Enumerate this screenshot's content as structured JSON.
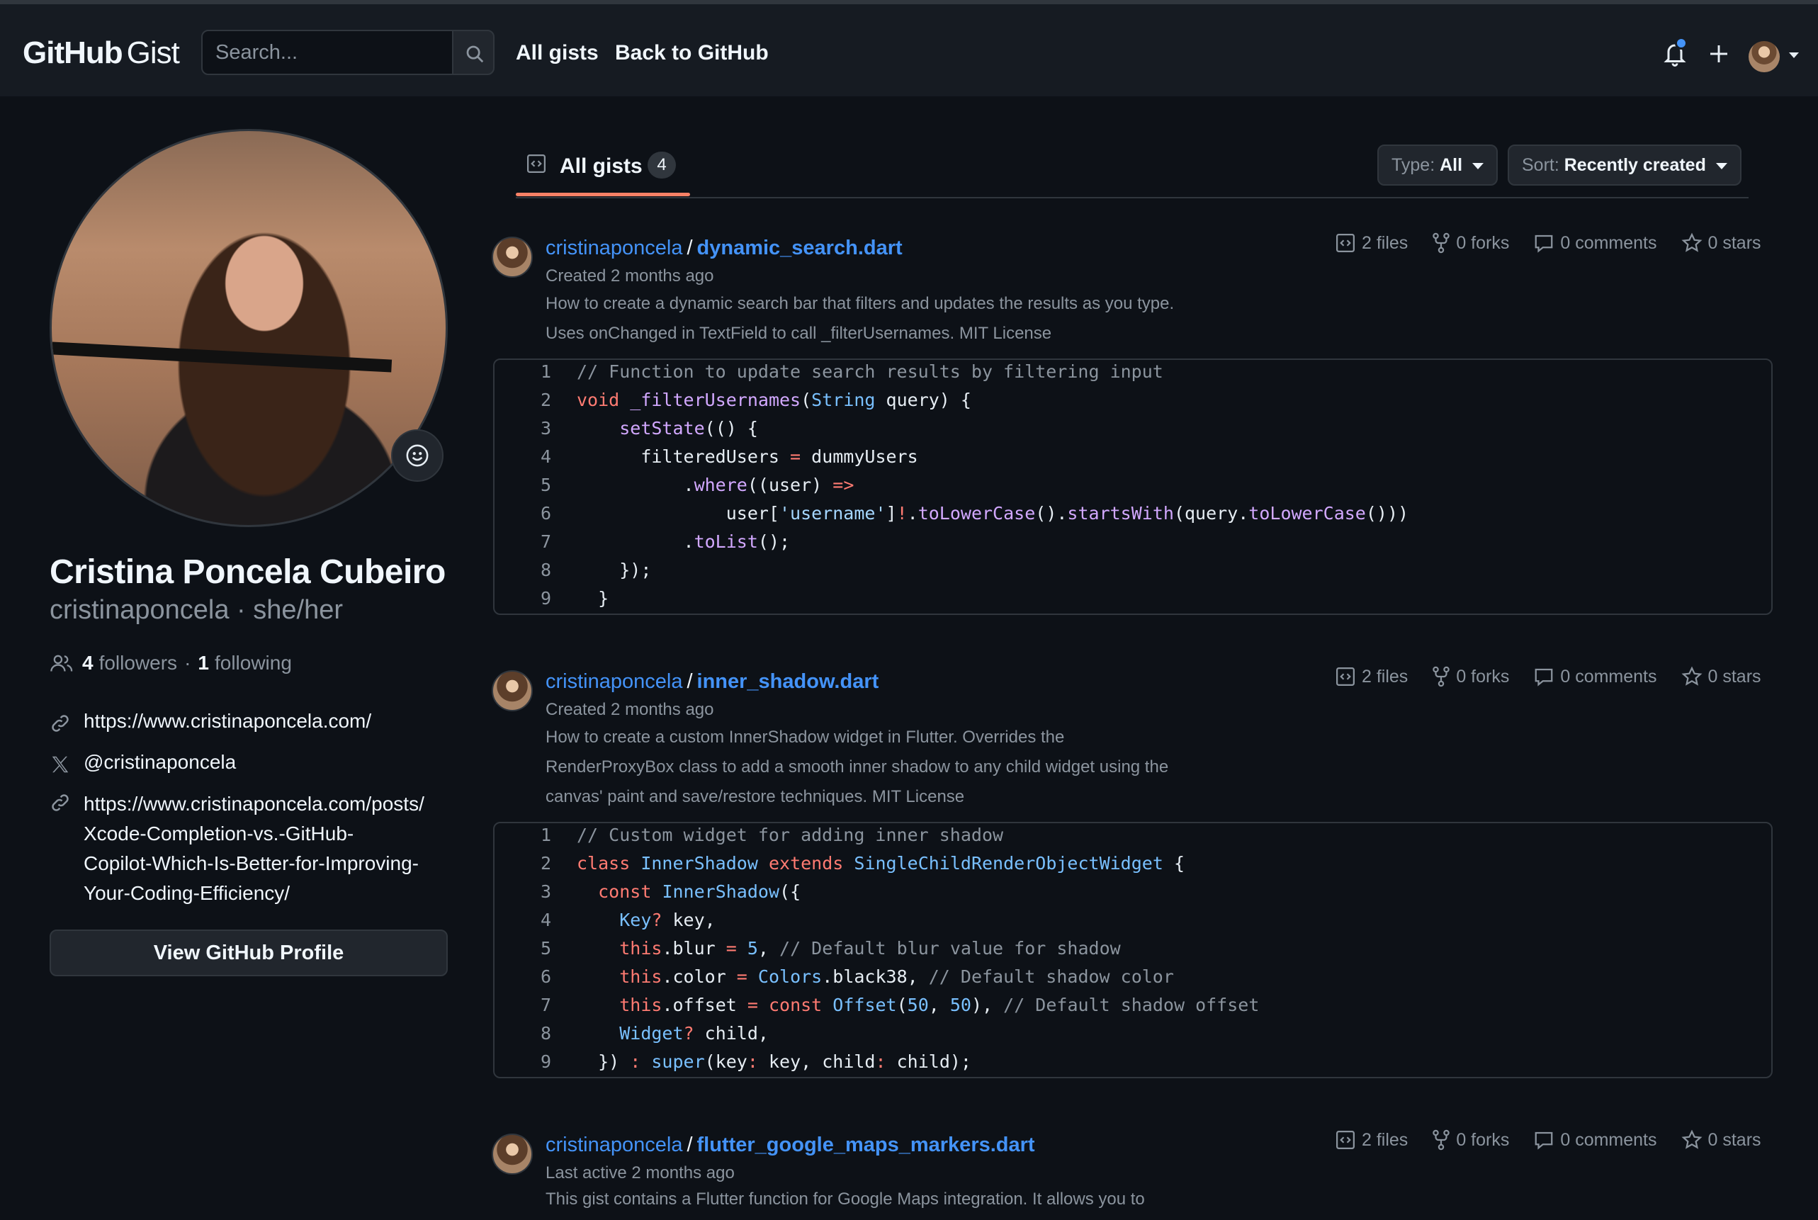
{
  "header": {
    "logo_brand": "GitHub",
    "logo_product": "Gist",
    "search_placeholder": "Search...",
    "nav": [
      "All gists",
      "Back to GitHub"
    ],
    "icons": [
      "bell-icon",
      "plus-icon",
      "avatar",
      "caret-down-icon"
    ],
    "accent": "#4493f8"
  },
  "profile": {
    "full_name": "Cristina Poncela Cubeiro",
    "handle_line": "cristinaponcela · she/her",
    "followers_count": "4",
    "followers_label": "followers",
    "separator": "·",
    "following_count": "1",
    "following_label": "following",
    "website": "https://www.cristinaponcela.com/",
    "twitter": "@cristinaponcela",
    "post_link_lines": [
      "https://www.cristinaponcela.com/posts/",
      "Xcode-Completion-vs.-GitHub-",
      "Copilot-Which-Is-Better-for-Improving-",
      "Your-Coding-Efficiency/"
    ],
    "view_profile_button": "View GitHub Profile"
  },
  "tabs": {
    "all_gists_label": "All gists",
    "all_gists_count": "4",
    "type_filter_label": "Type:",
    "type_filter_value": "All",
    "sort_filter_label": "Sort:",
    "sort_filter_value": "Recently created"
  },
  "gists": [
    {
      "owner": "cristinaponcela",
      "slash": "/",
      "file": "dynamic_search.dart",
      "meta": "Created 2 months ago",
      "desc_lines": [
        "How to create a dynamic search bar that filters and updates the results as you type.",
        "Uses onChanged in TextField to call _filterUsernames. MIT License"
      ],
      "files": "2 files",
      "forks": "0 forks",
      "comments": "0 comments",
      "stars": "0 stars"
    },
    {
      "owner": "cristinaponcela",
      "slash": "/",
      "file": "inner_shadow.dart",
      "meta": "Created 2 months ago",
      "desc_lines": [
        "How to create a custom InnerShadow widget in Flutter. Overrides the",
        "RenderProxyBox class to add a smooth inner shadow to any child widget using the",
        "canvas' paint and save/restore techniques. MIT License"
      ],
      "files": "2 files",
      "forks": "0 forks",
      "comments": "0 comments",
      "stars": "0 stars"
    },
    {
      "owner": "cristinaponcela",
      "slash": "/",
      "file": "flutter_google_maps_markers.dart",
      "meta": "Last active 2 months ago",
      "desc_lines": [
        "This gist contains a Flutter function for Google Maps integration. It allows you to"
      ],
      "files": "2 files",
      "forks": "0 forks",
      "comments": "0 comments",
      "stars": "0 stars"
    }
  ],
  "code1": {
    "line_numbers": [
      "1",
      "2",
      "3",
      "4",
      "5",
      "6",
      "7",
      "8",
      "9"
    ],
    "l1": "// Function to update search results by filtering input",
    "l2_kw": "void",
    "l2_fn": "_filterUsernames",
    "l2_p1": "(",
    "l2_ty": "String",
    "l2_p2": " query) {",
    "l3_fn": "setState",
    "l3_p": "(() {",
    "l4_a": "filteredUsers ",
    "l4_op": "=",
    "l4_b": " dummyUsers",
    "l5_a": ".",
    "l5_fn": "where",
    "l5_b": "((user) ",
    "l5_op": "=>",
    "l6_a": "user[",
    "l6_st": "'username'",
    "l6_b": "]",
    "l6_op": "!",
    "l6_c": ".",
    "l6_fn1": "toLowerCase",
    "l6_d": "().",
    "l6_fn2": "startsWith",
    "l6_e": "(query.",
    "l6_fn3": "toLowerCase",
    "l6_f": "()))",
    "l7_a": ".",
    "l7_fn": "toList",
    "l7_b": "();",
    "l8": "});",
    "l9": "}"
  },
  "code2": {
    "line_numbers": [
      "1",
      "2",
      "3",
      "4",
      "5",
      "6",
      "7",
      "8",
      "9"
    ],
    "l1": "// Custom widget for adding inner shadow",
    "l2_kw1": "class",
    "l2_ty1": "InnerShadow",
    "l2_kw2": "extends",
    "l2_ty2": "SingleChildRenderObjectWidget",
    "l2_b": " {",
    "l3_kw": "const",
    "l3_ty": "InnerShadow",
    "l3_b": "({",
    "l4_ty": "Key",
    "l4_op": "?",
    "l4_b": " key,",
    "l5_kw": "this",
    "l5_a": ".blur ",
    "l5_op": "=",
    "l5_nm": " 5",
    "l5_b": ", ",
    "l5_cm": "// Default blur value for shadow",
    "l6_kw": "this",
    "l6_a": ".color ",
    "l6_op": "=",
    "l6_ty": " Colors",
    "l6_b": ".black38, ",
    "l6_cm": "// Default shadow color",
    "l7_kw": "this",
    "l7_a": ".offset ",
    "l7_op": "=",
    "l7_kw2": " const",
    "l7_ty": " Offset",
    "l7_b": "(",
    "l7_nm1": "50",
    "l7_c": ", ",
    "l7_nm2": "50",
    "l7_d": "), ",
    "l7_cm": "// Default shadow offset",
    "l8_ty": "Widget",
    "l8_op": "?",
    "l8_b": " child,",
    "l9_a": "}) ",
    "l9_op": ":",
    "l9_kw": " super",
    "l9_b": "(key",
    "l9_op2": ":",
    "l9_c": " key, child",
    "l9_op3": ":",
    "l9_d": " child);"
  }
}
